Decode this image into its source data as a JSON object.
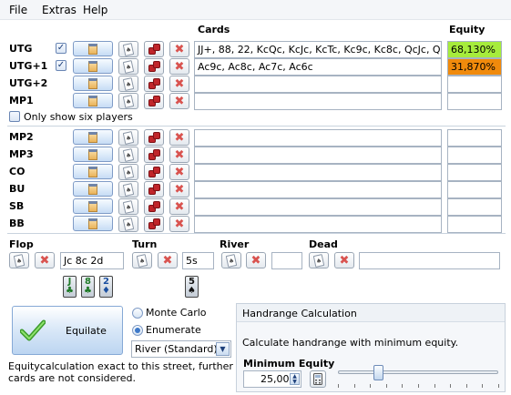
{
  "menu": {
    "file": "File",
    "extras": "Extras",
    "help": "Help"
  },
  "headers": {
    "cards": "Cards",
    "equity": "Equity"
  },
  "players": [
    {
      "label": "UTG",
      "checked": true,
      "cards": "JJ+, 88, 22, KcQc, KcJc, KcTc, Kc9c, Kc8c, QcJc, QcTc, Q",
      "equity": "68,130%",
      "equity_color": "#a6ec3c"
    },
    {
      "label": "UTG+1",
      "checked": true,
      "cards": "Ac9c, Ac8c, Ac7c, Ac6c",
      "equity": "31,870%",
      "equity_color": "#f08a0c"
    },
    {
      "label": "UTG+2",
      "checked": false,
      "cards": "",
      "equity": ""
    },
    {
      "label": "MP1",
      "checked": false,
      "cards": "",
      "equity": ""
    },
    {
      "label": "MP2",
      "checked": false,
      "cards": "",
      "equity": ""
    },
    {
      "label": "MP3",
      "checked": false,
      "cards": "",
      "equity": ""
    },
    {
      "label": "CO",
      "checked": false,
      "cards": "",
      "equity": ""
    },
    {
      "label": "BU",
      "checked": false,
      "cards": "",
      "equity": ""
    },
    {
      "label": "SB",
      "checked": false,
      "cards": "",
      "equity": ""
    },
    {
      "label": "BB",
      "checked": false,
      "cards": "",
      "equity": ""
    }
  ],
  "six_players_label": "Only show six players",
  "board": {
    "flop_label": "Flop",
    "flop_value": "Jc 8c 2d",
    "turn_label": "Turn",
    "turn_value": "5s",
    "river_label": "River",
    "river_value": "",
    "dead_label": "Dead",
    "dead_value": "",
    "flop_cards": [
      {
        "rank": "J",
        "suit": "♣",
        "color": "#1f7a28"
      },
      {
        "rank": "8",
        "suit": "♣",
        "color": "#1f7a28"
      },
      {
        "rank": "2",
        "suit": "♦",
        "color": "#1b4fa0"
      }
    ],
    "turn_cards": [
      {
        "rank": "5",
        "suit": "♠",
        "color": "#111111"
      }
    ]
  },
  "calc": {
    "equilate_label": "Equilate",
    "monte_carlo_label": "Monte Carlo",
    "enumerate_label": "Enumerate",
    "selected_mode": "Enumerate",
    "street_select": "River (Standard)",
    "note": "Equitycalculation exact to this street, further cards are not considered."
  },
  "handrange": {
    "title": "Handrange Calculation",
    "description": "Calculate handrange with minimum equity.",
    "min_equity_label": "Minimum Equity",
    "min_equity_value": "25,00",
    "slider_percent": 25
  },
  "icons": {
    "checkmark": "check-icon",
    "notepad": "notepad-icon",
    "card": "card-icon",
    "dice": "dice-icon",
    "remove": "x-icon",
    "calculator": "calculator-icon"
  }
}
